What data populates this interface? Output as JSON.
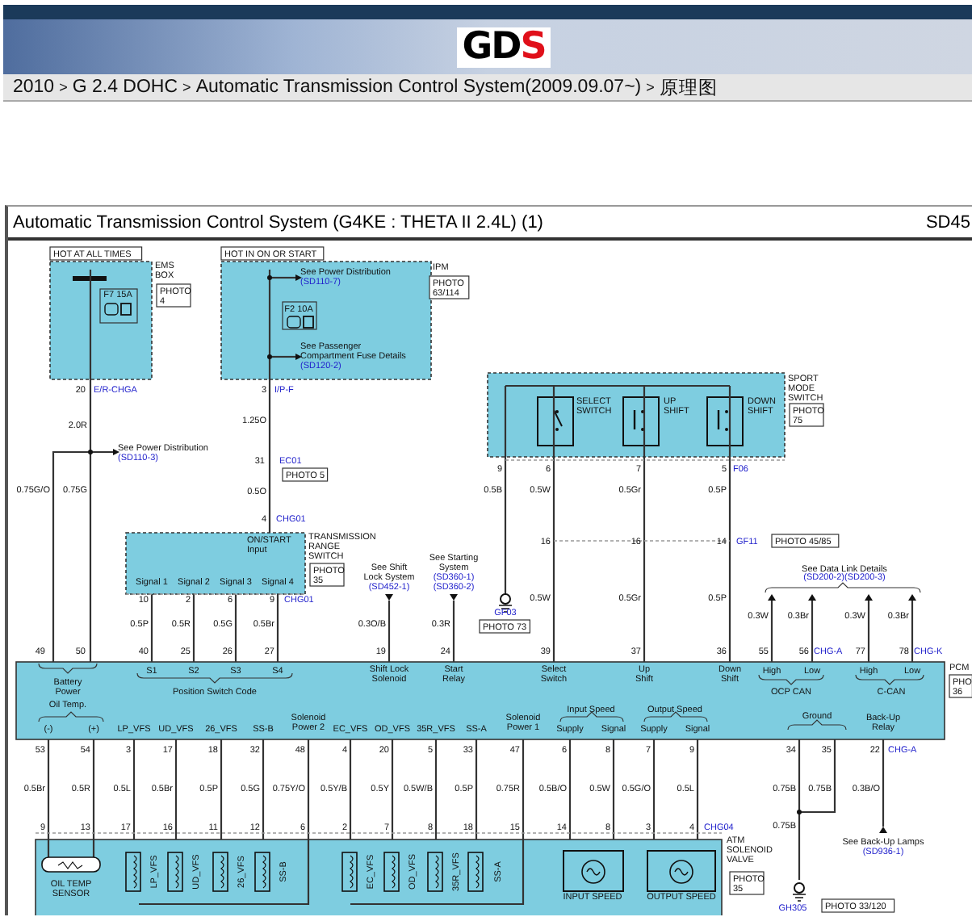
{
  "header": {
    "logo": {
      "main": "GD",
      "accent": "S"
    },
    "breadcrumb": [
      {
        "label": "2010"
      },
      {
        "label": "G 2.4 DOHC"
      },
      {
        "label": "Automatic Transmission Control System(2009.09.07~)"
      },
      {
        "label": "原理图"
      }
    ],
    "separators": [
      ">",
      ">",
      ">"
    ]
  },
  "diagram": {
    "title": "Automatic Transmission Control System (G4KE : THETA II 2.4L) (1)",
    "code": "SD45",
    "labels": [
      {
        "kind": "tag",
        "text": "HOT AT ALL TIMES"
      },
      {
        "kind": "label",
        "lines": [
          "F7 15A"
        ]
      },
      {
        "kind": "label",
        "lines": [
          "EMS",
          "BOX"
        ]
      },
      {
        "kind": "photo",
        "lines": [
          "PHOTO",
          "4"
        ]
      },
      {
        "kind": "pin",
        "text": "20"
      },
      {
        "kind": "connector",
        "text": "E/R-CHGA"
      },
      {
        "kind": "wire",
        "text": "2.0R"
      },
      {
        "kind": "note",
        "lines": [
          "See Power Distribution"
        ]
      },
      {
        "kind": "link",
        "text": "(SD110-3)"
      },
      {
        "kind": "wire",
        "text": "0.75G/O"
      },
      {
        "kind": "wire",
        "text": "0.75G"
      },
      {
        "kind": "tag",
        "text": "HOT IN ON OR START"
      },
      {
        "kind": "label",
        "lines": [
          "IPM"
        ]
      },
      {
        "kind": "photo",
        "lines": [
          "PHOTO",
          "63/114"
        ]
      },
      {
        "kind": "note",
        "lines": [
          "See Power Distribution"
        ]
      },
      {
        "kind": "link",
        "text": "(SD110-7)"
      },
      {
        "kind": "label",
        "lines": [
          "F2 10A"
        ]
      },
      {
        "kind": "note",
        "lines": [
          "See Passenger",
          "Compartment Fuse Details"
        ]
      },
      {
        "kind": "link",
        "text": "(SD120-2)"
      },
      {
        "kind": "pin",
        "text": "3"
      },
      {
        "kind": "connector",
        "text": "I/P-F"
      },
      {
        "kind": "wire",
        "text": "1.25O"
      },
      {
        "kind": "pin",
        "text": "31"
      },
      {
        "kind": "connector",
        "text": "EC01"
      },
      {
        "kind": "photo",
        "lines": [
          "PHOTO 5"
        ]
      },
      {
        "kind": "wire",
        "text": "0.5O"
      },
      {
        "kind": "pin",
        "text": "4"
      },
      {
        "kind": "connector",
        "text": "CHG01"
      },
      {
        "kind": "label",
        "lines": [
          "ON/START",
          "Input"
        ]
      },
      {
        "kind": "label",
        "lines": [
          "TRANSMISSION",
          "RANGE",
          "SWITCH"
        ]
      },
      {
        "kind": "photo",
        "lines": [
          "PHOTO",
          "35"
        ]
      },
      {
        "kind": "label",
        "lines": [
          "Signal 1"
        ]
      },
      {
        "kind": "label",
        "lines": [
          "Signal 2"
        ]
      },
      {
        "kind": "label",
        "lines": [
          "Signal 3"
        ]
      },
      {
        "kind": "label",
        "lines": [
          "Signal 4"
        ]
      },
      {
        "kind": "pin",
        "text": "10"
      },
      {
        "kind": "pin",
        "text": "2"
      },
      {
        "kind": "pin",
        "text": "6"
      },
      {
        "kind": "pin",
        "text": "9"
      },
      {
        "kind": "connector",
        "text": "CHG01"
      },
      {
        "kind": "note",
        "lines": [
          "See Shift",
          "Lock System"
        ]
      },
      {
        "kind": "link",
        "text": "(SD452-1)"
      },
      {
        "kind": "note",
        "lines": [
          "See Starting",
          "System"
        ]
      },
      {
        "kind": "link",
        "text": "(SD360-1)"
      },
      {
        "kind": "link",
        "text": "(SD360-2)"
      },
      {
        "kind": "wire",
        "text": "0.5P"
      },
      {
        "kind": "wire",
        "text": "0.5R"
      },
      {
        "kind": "wire",
        "text": "0.5G"
      },
      {
        "kind": "wire",
        "text": "0.5Br"
      },
      {
        "kind": "wire",
        "text": "0.3O/B"
      },
      {
        "kind": "wire",
        "text": "0.3R"
      },
      {
        "kind": "label",
        "lines": [
          "SPORT",
          "MODE",
          "SWITCH"
        ]
      },
      {
        "kind": "photo",
        "lines": [
          "PHOTO",
          "75"
        ]
      },
      {
        "kind": "label",
        "lines": [
          "SELECT",
          "SWITCH"
        ]
      },
      {
        "kind": "label",
        "lines": [
          "UP",
          "SHIFT"
        ]
      },
      {
        "kind": "label",
        "lines": [
          "DOWN",
          "SHIFT"
        ]
      },
      {
        "kind": "pin",
        "text": "9"
      },
      {
        "kind": "pin",
        "text": "6"
      },
      {
        "kind": "pin",
        "text": "7"
      },
      {
        "kind": "pin",
        "text": "5"
      },
      {
        "kind": "connector",
        "text": "F06"
      },
      {
        "kind": "wire",
        "text": "0.5B"
      },
      {
        "kind": "wire",
        "text": "0.5W"
      },
      {
        "kind": "wire",
        "text": "0.5Gr"
      },
      {
        "kind": "wire",
        "text": "0.5P"
      },
      {
        "kind": "pin",
        "text": "16"
      },
      {
        "kind": "pin",
        "text": "16"
      },
      {
        "kind": "pin",
        "text": "14"
      },
      {
        "kind": "connector",
        "text": "GF11"
      },
      {
        "kind": "photo",
        "lines": [
          "PHOTO 45/85"
        ]
      },
      {
        "kind": "connector",
        "text": "GF03"
      },
      {
        "kind": "photo",
        "lines": [
          "PHOTO 73"
        ]
      },
      {
        "kind": "wire",
        "text": "0.5W"
      },
      {
        "kind": "wire",
        "text": "0.5Gr"
      },
      {
        "kind": "wire",
        "text": "0.5P"
      },
      {
        "kind": "note",
        "lines": [
          "See Data Link Details"
        ]
      },
      {
        "kind": "link",
        "text": "(SD200-2)(SD200-3)"
      },
      {
        "kind": "wire",
        "text": "0.3W"
      },
      {
        "kind": "wire",
        "text": "0.3Br"
      },
      {
        "kind": "wire",
        "text": "0.3W"
      },
      {
        "kind": "wire",
        "text": "0.3Br"
      },
      {
        "kind": "pin",
        "text": "49"
      },
      {
        "kind": "pin",
        "text": "50"
      },
      {
        "kind": "pin",
        "text": "40"
      },
      {
        "kind": "pin",
        "text": "25"
      },
      {
        "kind": "pin",
        "text": "26"
      },
      {
        "kind": "pin",
        "text": "27"
      },
      {
        "kind": "pin",
        "text": "19"
      },
      {
        "kind": "pin",
        "text": "24"
      },
      {
        "kind": "pin",
        "text": "39"
      },
      {
        "kind": "pin",
        "text": "37"
      },
      {
        "kind": "pin",
        "text": "36"
      },
      {
        "kind": "pin",
        "text": "55"
      },
      {
        "kind": "pin",
        "text": "56"
      },
      {
        "kind": "connector",
        "text": "CHG-A"
      },
      {
        "kind": "pin",
        "text": "77"
      },
      {
        "kind": "pin",
        "text": "78"
      },
      {
        "kind": "connector",
        "text": "CHG-K"
      },
      {
        "kind": "label",
        "lines": [
          "Battery",
          "Power"
        ]
      },
      {
        "kind": "label",
        "lines": [
          "S1"
        ]
      },
      {
        "kind": "label",
        "lines": [
          "S2"
        ]
      },
      {
        "kind": "label",
        "lines": [
          "S3"
        ]
      },
      {
        "kind": "label",
        "lines": [
          "S4"
        ]
      },
      {
        "kind": "label",
        "lines": [
          "Position Switch Code"
        ]
      },
      {
        "kind": "label",
        "lines": [
          "Shift Lock",
          "Solenoid"
        ]
      },
      {
        "kind": "label",
        "lines": [
          "Start",
          "Relay"
        ]
      },
      {
        "kind": "label",
        "lines": [
          "Select",
          "Switch"
        ]
      },
      {
        "kind": "label",
        "lines": [
          "Up",
          "Shift"
        ]
      },
      {
        "kind": "label",
        "lines": [
          "Down",
          "Shift"
        ]
      },
      {
        "kind": "label",
        "lines": [
          "High"
        ]
      },
      {
        "kind": "label",
        "lines": [
          "Low"
        ]
      },
      {
        "kind": "label",
        "lines": [
          "OCP CAN"
        ]
      },
      {
        "kind": "label",
        "lines": [
          "High"
        ]
      },
      {
        "kind": "label",
        "lines": [
          "Low"
        ]
      },
      {
        "kind": "label",
        "lines": [
          "C-CAN"
        ]
      },
      {
        "kind": "label",
        "lines": [
          "PCM"
        ]
      },
      {
        "kind": "photo",
        "lines": [
          "PHO",
          "36"
        ]
      },
      {
        "kind": "label",
        "lines": [
          "Oil Temp."
        ]
      },
      {
        "kind": "label",
        "lines": [
          "(-)"
        ]
      },
      {
        "kind": "label",
        "lines": [
          "(+)"
        ]
      },
      {
        "kind": "label",
        "lines": [
          "LP_VFS"
        ]
      },
      {
        "kind": "label",
        "lines": [
          "UD_VFS"
        ]
      },
      {
        "kind": "label",
        "lines": [
          "26_VFS"
        ]
      },
      {
        "kind": "label",
        "lines": [
          "SS-B"
        ]
      },
      {
        "kind": "label",
        "lines": [
          "Solenoid",
          "Power 2"
        ]
      },
      {
        "kind": "label",
        "lines": [
          "EC_VFS"
        ]
      },
      {
        "kind": "label",
        "lines": [
          "OD_VFS"
        ]
      },
      {
        "kind": "label",
        "lines": [
          "35R_VFS"
        ]
      },
      {
        "kind": "label",
        "lines": [
          "SS-A"
        ]
      },
      {
        "kind": "label",
        "lines": [
          "Solenoid",
          "Power 1"
        ]
      },
      {
        "kind": "label",
        "lines": [
          "Input Speed"
        ]
      },
      {
        "kind": "label",
        "lines": [
          "Supply"
        ]
      },
      {
        "kind": "label",
        "lines": [
          "Signal"
        ]
      },
      {
        "kind": "label",
        "lines": [
          "Output Speed"
        ]
      },
      {
        "kind": "label",
        "lines": [
          "Supply"
        ]
      },
      {
        "kind": "label",
        "lines": [
          "Signal"
        ]
      },
      {
        "kind": "label",
        "lines": [
          "Ground"
        ]
      },
      {
        "kind": "label",
        "lines": [
          "Back-Up",
          "Relay"
        ]
      },
      {
        "kind": "pin",
        "text": "53"
      },
      {
        "kind": "pin",
        "text": "54"
      },
      {
        "kind": "pin",
        "text": "3"
      },
      {
        "kind": "pin",
        "text": "17"
      },
      {
        "kind": "pin",
        "text": "18"
      },
      {
        "kind": "pin",
        "text": "32"
      },
      {
        "kind": "pin",
        "text": "48"
      },
      {
        "kind": "pin",
        "text": "4"
      },
      {
        "kind": "pin",
        "text": "20"
      },
      {
        "kind": "pin",
        "text": "5"
      },
      {
        "kind": "pin",
        "text": "33"
      },
      {
        "kind": "pin",
        "text": "47"
      },
      {
        "kind": "pin",
        "text": "6"
      },
      {
        "kind": "pin",
        "text": "8"
      },
      {
        "kind": "pin",
        "text": "7"
      },
      {
        "kind": "pin",
        "text": "9"
      },
      {
        "kind": "pin",
        "text": "34"
      },
      {
        "kind": "pin",
        "text": "35"
      },
      {
        "kind": "pin",
        "text": "22"
      },
      {
        "kind": "connector",
        "text": "CHG-A"
      },
      {
        "kind": "wire",
        "text": "0.5Br"
      },
      {
        "kind": "wire",
        "text": "0.5R"
      },
      {
        "kind": "wire",
        "text": "0.5L"
      },
      {
        "kind": "wire",
        "text": "0.5Br"
      },
      {
        "kind": "wire",
        "text": "0.5P"
      },
      {
        "kind": "wire",
        "text": "0.5G"
      },
      {
        "kind": "wire",
        "text": "0.75Y/O"
      },
      {
        "kind": "wire",
        "text": "0.5Y/B"
      },
      {
        "kind": "wire",
        "text": "0.5Y"
      },
      {
        "kind": "wire",
        "text": "0.5W/B"
      },
      {
        "kind": "wire",
        "text": "0.5P"
      },
      {
        "kind": "wire",
        "text": "0.75R"
      },
      {
        "kind": "wire",
        "text": "0.5B/O"
      },
      {
        "kind": "wire",
        "text": "0.5W"
      },
      {
        "kind": "wire",
        "text": "0.5G/O"
      },
      {
        "kind": "wire",
        "text": "0.5L"
      },
      {
        "kind": "wire",
        "text": "0.75B"
      },
      {
        "kind": "wire",
        "text": "0.75B"
      },
      {
        "kind": "wire",
        "text": "0.3B/O"
      },
      {
        "kind": "pin",
        "text": "9"
      },
      {
        "kind": "pin",
        "text": "13"
      },
      {
        "kind": "pin",
        "text": "17"
      },
      {
        "kind": "pin",
        "text": "16"
      },
      {
        "kind": "pin",
        "text": "11"
      },
      {
        "kind": "pin",
        "text": "12"
      },
      {
        "kind": "pin",
        "text": "6"
      },
      {
        "kind": "pin",
        "text": "2"
      },
      {
        "kind": "pin",
        "text": "7"
      },
      {
        "kind": "pin",
        "text": "8"
      },
      {
        "kind": "pin",
        "text": "18"
      },
      {
        "kind": "pin",
        "text": "15"
      },
      {
        "kind": "pin",
        "text": "14"
      },
      {
        "kind": "pin",
        "text": "8"
      },
      {
        "kind": "pin",
        "text": "3"
      },
      {
        "kind": "pin",
        "text": "4"
      },
      {
        "kind": "connector",
        "text": "CHG04"
      },
      {
        "kind": "wire",
        "text": "0.75B"
      },
      {
        "kind": "note",
        "lines": [
          "See Back-Up Lamps"
        ]
      },
      {
        "kind": "link",
        "text": "(SD936-1)"
      },
      {
        "kind": "connector",
        "text": "GH305"
      },
      {
        "kind": "photo",
        "lines": [
          "PHOTO 33/120"
        ]
      },
      {
        "kind": "label",
        "lines": [
          "ATM",
          "SOLENOID",
          "VALVE"
        ]
      },
      {
        "kind": "photo",
        "lines": [
          "PHOTO",
          "35"
        ]
      },
      {
        "kind": "label",
        "lines": [
          "OIL TEMP",
          "SENSOR"
        ]
      },
      {
        "kind": "vertical",
        "text": "LP_VFS"
      },
      {
        "kind": "vertical",
        "text": "UD_VFS"
      },
      {
        "kind": "vertical",
        "text": "26_VFS"
      },
      {
        "kind": "vertical",
        "text": "SS-B"
      },
      {
        "kind": "vertical",
        "text": "EC_VFS"
      },
      {
        "kind": "vertical",
        "text": "OD_VFS"
      },
      {
        "kind": "vertical",
        "text": "35R_VFS"
      },
      {
        "kind": "vertical",
        "text": "SS-A"
      },
      {
        "kind": "label",
        "lines": [
          "INPUT SPEED"
        ]
      },
      {
        "kind": "label",
        "lines": [
          "OUTPUT SPEED"
        ]
      }
    ]
  }
}
